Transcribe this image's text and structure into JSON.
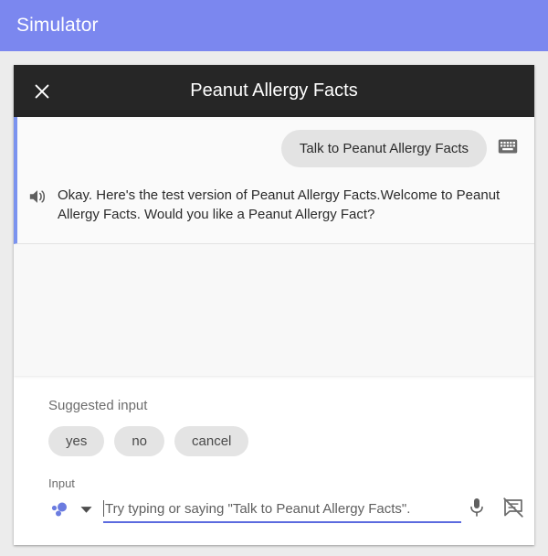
{
  "app_bar": {
    "title": "Simulator",
    "background": "#7b87ef"
  },
  "simulator": {
    "header": {
      "title": "Peanut Allergy Facts",
      "close_icon": "close-icon",
      "background": "#262626"
    },
    "conversation": {
      "accent_color": "#7b93ef",
      "turns": [
        {
          "user_message": "Talk to Peanut Allergy Facts",
          "input_mode_icon": "keyboard-icon",
          "agent_icon": "speaker-icon",
          "agent_message": "Okay. Here's the test version of Peanut Allergy Facts.Welcome to Peanut Allergy Facts. Would you like a Peanut Allergy Fact?"
        }
      ]
    },
    "suggested_input": {
      "label": "Suggested input",
      "chips": [
        "yes",
        "no",
        "cancel"
      ]
    },
    "input": {
      "label": "Input",
      "assistant_icon": "assistant-dots-icon",
      "dropdown_icon": "chevron-down-icon",
      "placeholder": "Try typing or saying \"Talk to Peanut Allergy Facts\".",
      "value": "",
      "mic_icon": "microphone-icon",
      "captions_icon": "captions-off-icon",
      "underline_color": "#5c6bdf"
    }
  }
}
